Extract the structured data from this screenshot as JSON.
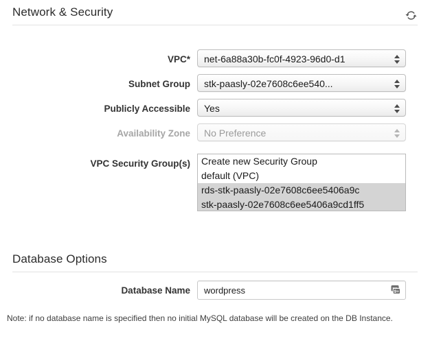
{
  "sections": [
    {
      "title": "Network & Security",
      "refresh_icon": "refresh-icon"
    },
    {
      "title": "Database Options"
    }
  ],
  "network": {
    "vpc": {
      "label": "VPC*",
      "value": "net-6a88a30b-fc0f-4923-96d0-d1",
      "disabled": false
    },
    "subnet_group": {
      "label": "Subnet Group",
      "value": "stk-paasly-02e7608c6ee540...",
      "disabled": false
    },
    "publicly_accessible": {
      "label": "Publicly Accessible",
      "value": "Yes",
      "disabled": false
    },
    "availability_zone": {
      "label": "Availability Zone",
      "value": "No Preference",
      "disabled": true
    },
    "security_groups": {
      "label": "VPC Security Group(s)",
      "options": [
        {
          "text": "Create new Security Group",
          "selected": false
        },
        {
          "text": "default (VPC)",
          "selected": false
        },
        {
          "text": "rds-stk-paasly-02e7608c6ee5406a9c",
          "selected": true
        },
        {
          "text": "stk-paasly-02e7608c6ee5406a9cd1ff5",
          "selected": true
        }
      ]
    }
  },
  "database_options": {
    "database_name": {
      "label": "Database Name",
      "value": "wordpress",
      "placeholder": "",
      "autofill_icon": "autofill-badge-icon"
    },
    "note": "Note: if no database name is specified then no initial MySQL database will be created on the DB Instance."
  }
}
